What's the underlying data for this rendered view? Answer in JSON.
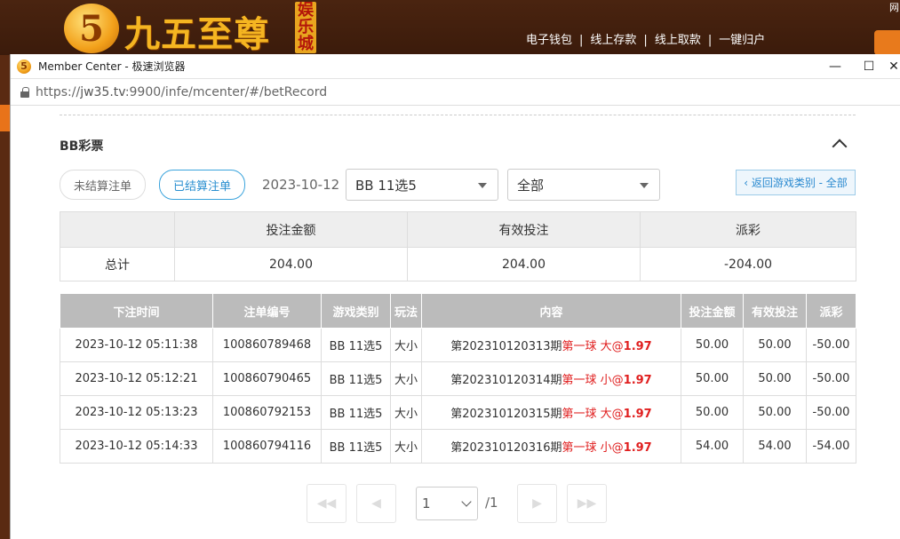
{
  "site": {
    "logo_glyph": "5",
    "logo_text": "九五至尊",
    "logo_tag": "娱乐城",
    "links": [
      "电子钱包",
      "线上存款",
      "线上取款",
      "一键归户"
    ],
    "link_separator": "|",
    "corner_text": "网"
  },
  "browser": {
    "title": "Member Center - 极速浏览器",
    "url_prefix": "https://",
    "url_host": "jw35.tv",
    "url_rest": ":9900/infe/mcenter/#/betRecord",
    "minimize": "—",
    "maximize": "☐",
    "close": "✕"
  },
  "section": {
    "title": "BB彩票"
  },
  "filters": {
    "unsettled_label": "未结算注单",
    "settled_label": "已结算注单",
    "date": "2023-10-12",
    "game_select": "BB 11选5",
    "type_select": "全部",
    "back_label": "‹ 返回游戏类别 - 全部"
  },
  "summary": {
    "headers": [
      "",
      "投注金额",
      "有效投注",
      "派彩"
    ],
    "row_label": "总计",
    "bet_amount": "204.00",
    "valid_bet": "204.00",
    "payout": "-204.00"
  },
  "records": {
    "headers": [
      "下注时间",
      "注单编号",
      "游戏类别",
      "玩法",
      "内容",
      "投注金额",
      "有效投注",
      "派彩"
    ],
    "rows": [
      {
        "time": "2023-10-12 05:11:38",
        "id": "100860789468",
        "game": "BB 11选5",
        "play": "大小",
        "period": "第202310120313期",
        "pick": "第一球 大@",
        "odds": "1.97",
        "bet": "50.00",
        "valid": "50.00",
        "payout": "-50.00"
      },
      {
        "time": "2023-10-12 05:12:21",
        "id": "100860790465",
        "game": "BB 11选5",
        "play": "大小",
        "period": "第202310120314期",
        "pick": "第一球 小@",
        "odds": "1.97",
        "bet": "50.00",
        "valid": "50.00",
        "payout": "-50.00"
      },
      {
        "time": "2023-10-12 05:13:23",
        "id": "100860792153",
        "game": "BB 11选5",
        "play": "大小",
        "period": "第202310120315期",
        "pick": "第一球 大@",
        "odds": "1.97",
        "bet": "50.00",
        "valid": "50.00",
        "payout": "-50.00"
      },
      {
        "time": "2023-10-12 05:14:33",
        "id": "100860794116",
        "game": "BB 11选5",
        "play": "大小",
        "period": "第202310120316期",
        "pick": "第一球 小@",
        "odds": "1.97",
        "bet": "54.00",
        "valid": "54.00",
        "payout": "-54.00"
      }
    ]
  },
  "pagination": {
    "first": "◀◀",
    "prev": "◀",
    "next": "▶",
    "last": "▶▶",
    "current_page": "1",
    "total": "/1"
  }
}
